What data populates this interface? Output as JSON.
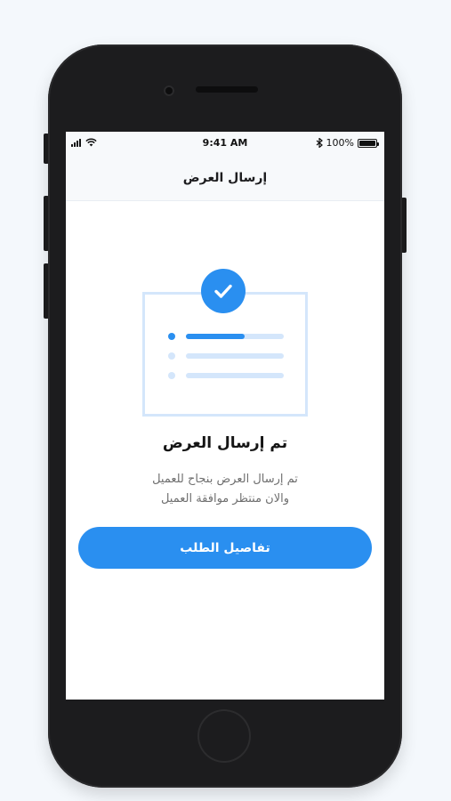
{
  "status_bar": {
    "time": "9:41 AM",
    "battery_percent": "100%",
    "icons": [
      "signal-icon",
      "wifi-icon",
      "bluetooth-icon",
      "battery-icon"
    ]
  },
  "nav": {
    "title": "إرسال العرض"
  },
  "illustration": {
    "icon": "check-icon",
    "progress_fraction": 0.6
  },
  "content": {
    "title": "تم إرسال العرض",
    "description_line1": "تم إرسال العرض بنجاح للعميل",
    "description_line2": "والان منتظر موافقة العميل"
  },
  "actions": {
    "details_button_label": "تفاصيل الطلب"
  },
  "colors": {
    "accent": "#2a8ff0",
    "accent_light": "#d4e6fb",
    "background": "#f4f8fc",
    "device": "#1c1c1e"
  }
}
